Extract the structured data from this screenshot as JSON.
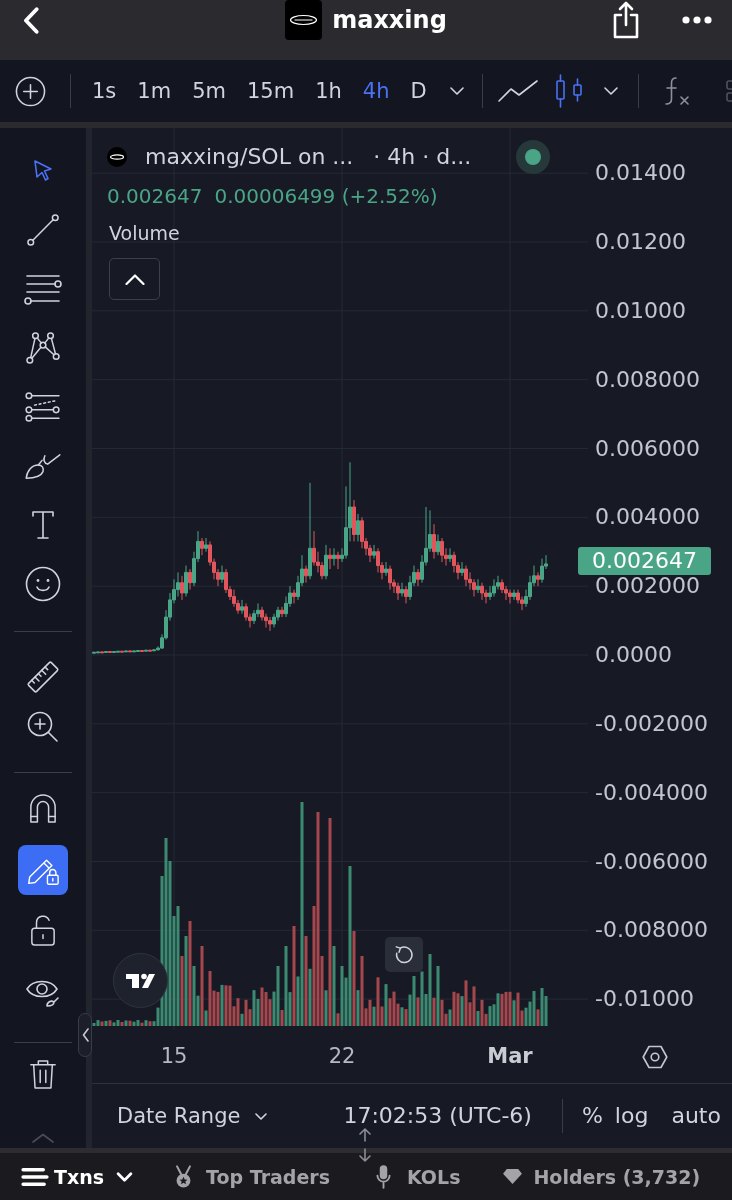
{
  "header": {
    "title": "maxxing"
  },
  "toolbar": {
    "intervals": [
      {
        "label": "1s",
        "selected": false
      },
      {
        "label": "1m",
        "selected": false
      },
      {
        "label": "5m",
        "selected": false
      },
      {
        "label": "15m",
        "selected": false
      },
      {
        "label": "1h",
        "selected": false
      },
      {
        "label": "4h",
        "selected": true
      },
      {
        "label": "D",
        "selected": false
      }
    ],
    "chart_types": [
      {
        "selected": false
      },
      {
        "selected": true
      }
    ]
  },
  "drawing_toolbar": {
    "tools": [
      {
        "selected": true
      },
      {
        "selected": false
      },
      {
        "selected": false
      },
      {
        "selected": false
      },
      {
        "selected": false
      },
      {
        "selected": false
      },
      {
        "selected": false
      },
      {
        "selected": false
      }
    ],
    "toggles": [
      {
        "on": false
      },
      {
        "on": true
      },
      {
        "on": false
      },
      {
        "on": false
      }
    ]
  },
  "chart": {
    "legend": {
      "symbol": "maxxing/SOL on ...",
      "details": "· 4h · d...",
      "price": "0.002647",
      "change": "0.00006499 (+2.52%)",
      "study": "Volume"
    },
    "last_price": "0.002647",
    "time_axis": {
      "ticks": [
        {
          "kind": "day"
        },
        {
          "kind": "day"
        },
        {
          "kind": "month"
        }
      ]
    },
    "chart_data": {
      "type": "candlestick",
      "grid": true,
      "xlim": [
        11.583,
        32.25
      ],
      "ylim": [
        -0.010897,
        0.015313
      ],
      "yticks": [
        {
          "value": 0.014,
          "label": "0.01400"
        },
        {
          "value": 0.012,
          "label": "0.01200"
        },
        {
          "value": 0.01,
          "label": "0.01000"
        },
        {
          "value": 0.008,
          "label": "0.008000"
        },
        {
          "value": 0.006,
          "label": "0.006000"
        },
        {
          "value": 0.004,
          "label": "0.004000"
        },
        {
          "value": 0.002,
          "label": "0.002000"
        },
        {
          "value": 0,
          "label": "0.0000"
        },
        {
          "value": -0.002,
          "label": "-0.002000"
        },
        {
          "value": -0.004,
          "label": "-0.004000"
        },
        {
          "value": -0.006,
          "label": "-0.006000"
        },
        {
          "value": -0.008,
          "label": "-0.008000"
        },
        {
          "value": -0.01,
          "label": "-0.01000"
        }
      ],
      "xticks": [
        {
          "value": 15,
          "label": "15"
        },
        {
          "value": 22,
          "label": "22"
        },
        {
          "value": 29,
          "label": "Mar"
        }
      ],
      "x": [
        11.667,
        11.833,
        12,
        12.167,
        12.333,
        12.5,
        12.667,
        12.833,
        13,
        13.167,
        13.333,
        13.5,
        13.667,
        13.833,
        14,
        14.167,
        14.333,
        14.5,
        14.667,
        14.833,
        15,
        15.167,
        15.333,
        15.5,
        15.667,
        15.833,
        16,
        16.167,
        16.333,
        16.5,
        16.667,
        16.833,
        17,
        17.167,
        17.333,
        17.5,
        17.667,
        17.833,
        18,
        18.167,
        18.333,
        18.5,
        18.667,
        18.833,
        19,
        19.167,
        19.333,
        19.5,
        19.667,
        19.833,
        20,
        20.167,
        20.333,
        20.5,
        20.667,
        20.833,
        21,
        21.167,
        21.333,
        21.5,
        21.667,
        21.833,
        22,
        22.167,
        22.333,
        22.5,
        22.667,
        22.833,
        23,
        23.167,
        23.333,
        23.5,
        23.667,
        23.833,
        24,
        24.167,
        24.333,
        24.5,
        24.667,
        24.833,
        25,
        25.167,
        25.333,
        25.5,
        25.667,
        25.833,
        26,
        26.167,
        26.333,
        26.5,
        26.667,
        26.833,
        27,
        27.167,
        27.333,
        27.5,
        27.667,
        27.833,
        28,
        28.167,
        28.333,
        28.5,
        28.667,
        28.833,
        29,
        29.167,
        29.333,
        29.5,
        29.667,
        29.833,
        30,
        30.167,
        30.333,
        30.5
      ],
      "ohlc": [
        [
          7e-05,
          9e-05,
          6e-05,
          8e-05
        ],
        [
          8e-05,
          0.0001,
          7e-05,
          9e-05
        ],
        [
          9e-05,
          0.0001,
          7e-05,
          8e-05
        ],
        [
          8e-05,
          0.00011,
          7e-05,
          0.0001
        ],
        [
          0.0001,
          0.00011,
          8e-05,
          9e-05
        ],
        [
          9e-05,
          0.00011,
          8e-05,
          0.0001
        ],
        [
          0.0001,
          0.00012,
          9e-05,
          0.00011
        ],
        [
          0.00011,
          0.00012,
          9e-05,
          0.0001
        ],
        [
          0.0001,
          0.00013,
          9e-05,
          0.00012
        ],
        [
          0.00012,
          0.00013,
          0.0001,
          0.00011
        ],
        [
          0.00011,
          0.00013,
          0.0001,
          0.00012
        ],
        [
          0.00012,
          0.00014,
          0.00011,
          0.00013
        ],
        [
          0.00013,
          0.00014,
          0.00011,
          0.00012
        ],
        [
          0.00012,
          0.00015,
          0.00011,
          0.00014
        ],
        [
          0.00014,
          0.00015,
          0.00012,
          0.00013
        ],
        [
          0.00013,
          0.00017,
          0.00012,
          0.00015
        ],
        [
          0.00015,
          0.00025,
          0.00013,
          0.0002
        ],
        [
          0.0002,
          0.0006,
          0.00018,
          0.0005
        ],
        [
          0.0005,
          0.0013,
          0.00045,
          0.0011
        ],
        [
          0.0011,
          0.0018,
          0.001,
          0.0016
        ],
        [
          0.0016,
          0.0022,
          0.0015,
          0.0019
        ],
        [
          0.0019,
          0.0024,
          0.0017,
          0.0021
        ],
        [
          0.0021,
          0.0023,
          0.0016,
          0.0018
        ],
        [
          0.0018,
          0.0026,
          0.0017,
          0.0024
        ],
        [
          0.0024,
          0.0025,
          0.0019,
          0.0021
        ],
        [
          0.0021,
          0.003,
          0.002,
          0.0028
        ],
        [
          0.0028,
          0.0036,
          0.0027,
          0.0033
        ],
        [
          0.0033,
          0.0034,
          0.0029,
          0.0031
        ],
        [
          0.0031,
          0.0034,
          0.003,
          0.0032
        ],
        [
          0.0032,
          0.0033,
          0.0026,
          0.0027
        ],
        [
          0.0027,
          0.0028,
          0.0022,
          0.0024
        ],
        [
          0.0024,
          0.0025,
          0.002,
          0.0022
        ],
        [
          0.0022,
          0.0026,
          0.0021,
          0.0024
        ],
        [
          0.0024,
          0.0025,
          0.0018,
          0.0019
        ],
        [
          0.0019,
          0.002,
          0.0016,
          0.0017
        ],
        [
          0.0017,
          0.0019,
          0.0014,
          0.0015
        ],
        [
          0.0015,
          0.0016,
          0.0012,
          0.0013
        ],
        [
          0.0013,
          0.0016,
          0.0012,
          0.0014
        ],
        [
          0.0014,
          0.0015,
          0.001,
          0.0011
        ],
        [
          0.0011,
          0.0012,
          0.0008,
          0.001
        ],
        [
          0.001,
          0.0013,
          0.0009,
          0.0012
        ],
        [
          0.0012,
          0.0015,
          0.0011,
          0.0013
        ],
        [
          0.0013,
          0.0014,
          0.001,
          0.0011
        ],
        [
          0.0011,
          0.0012,
          0.0008,
          0.001
        ],
        [
          0.001,
          0.0011,
          0.0007,
          0.0009
        ],
        [
          0.0009,
          0.0012,
          0.0008,
          0.0011
        ],
        [
          0.0011,
          0.0014,
          0.001,
          0.0013
        ],
        [
          0.0013,
          0.0014,
          0.0011,
          0.0012
        ],
        [
          0.0012,
          0.0017,
          0.0011,
          0.0015
        ],
        [
          0.0015,
          0.002,
          0.0014,
          0.0018
        ],
        [
          0.0018,
          0.0019,
          0.0015,
          0.0017
        ],
        [
          0.0017,
          0.0023,
          0.0016,
          0.0021
        ],
        [
          0.0021,
          0.0029,
          0.002,
          0.0025
        ],
        [
          0.0025,
          0.0026,
          0.0021,
          0.0023
        ],
        [
          0.0023,
          0.005,
          0.0022,
          0.0031
        ],
        [
          0.0031,
          0.0036,
          0.0026,
          0.0027
        ],
        [
          0.0027,
          0.003,
          0.0024,
          0.0026
        ],
        [
          0.0026,
          0.0027,
          0.0022,
          0.0023
        ],
        [
          0.0023,
          0.0032,
          0.0022,
          0.0029
        ],
        [
          0.0029,
          0.0031,
          0.0025,
          0.0028
        ],
        [
          0.0028,
          0.0031,
          0.0026,
          0.0029
        ],
        [
          0.0029,
          0.003,
          0.0025,
          0.0028
        ],
        [
          0.0028,
          0.0031,
          0.0027,
          0.0029
        ],
        [
          0.0029,
          0.0049,
          0.0028,
          0.0037
        ],
        [
          0.0037,
          0.0056,
          0.0033,
          0.0043
        ],
        [
          0.0043,
          0.0045,
          0.0033,
          0.0035
        ],
        [
          0.0035,
          0.0041,
          0.0033,
          0.0039
        ],
        [
          0.0039,
          0.004,
          0.0031,
          0.0033
        ],
        [
          0.0033,
          0.0034,
          0.0029,
          0.0031
        ],
        [
          0.0031,
          0.0032,
          0.0027,
          0.0029
        ],
        [
          0.0029,
          0.0032,
          0.0028,
          0.003
        ],
        [
          0.003,
          0.0031,
          0.0024,
          0.0026
        ],
        [
          0.0026,
          0.0027,
          0.0022,
          0.0024
        ],
        [
          0.0024,
          0.0027,
          0.0023,
          0.0025
        ],
        [
          0.0025,
          0.0026,
          0.0019,
          0.0021
        ],
        [
          0.0021,
          0.0022,
          0.0018,
          0.002
        ],
        [
          0.002,
          0.0021,
          0.0016,
          0.0018
        ],
        [
          0.0018,
          0.0021,
          0.0017,
          0.0019
        ],
        [
          0.0019,
          0.002,
          0.0015,
          0.0017
        ],
        [
          0.0017,
          0.0023,
          0.0016,
          0.0021
        ],
        [
          0.0021,
          0.0026,
          0.002,
          0.0024
        ],
        [
          0.0024,
          0.0025,
          0.002,
          0.0022
        ],
        [
          0.0022,
          0.0029,
          0.0021,
          0.0027
        ],
        [
          0.0027,
          0.0043,
          0.0026,
          0.0031
        ],
        [
          0.0031,
          0.0042,
          0.003,
          0.0035
        ],
        [
          0.0035,
          0.0038,
          0.0028,
          0.003
        ],
        [
          0.003,
          0.0035,
          0.0029,
          0.0033
        ],
        [
          0.0033,
          0.0034,
          0.0027,
          0.0029
        ],
        [
          0.0029,
          0.0031,
          0.0026,
          0.0028
        ],
        [
          0.0028,
          0.0031,
          0.0027,
          0.0029
        ],
        [
          0.0029,
          0.003,
          0.0024,
          0.0026
        ],
        [
          0.0026,
          0.0027,
          0.0022,
          0.0024
        ],
        [
          0.0024,
          0.0027,
          0.0023,
          0.0025
        ],
        [
          0.0025,
          0.0026,
          0.002,
          0.0022
        ],
        [
          0.0022,
          0.0024,
          0.0019,
          0.0021
        ],
        [
          0.0021,
          0.0022,
          0.0017,
          0.0019
        ],
        [
          0.0019,
          0.0022,
          0.0018,
          0.002
        ],
        [
          0.002,
          0.0021,
          0.0016,
          0.0018
        ],
        [
          0.0018,
          0.0019,
          0.0015,
          0.0017
        ],
        [
          0.0017,
          0.002,
          0.0016,
          0.0018
        ],
        [
          0.0018,
          0.0022,
          0.0017,
          0.002
        ],
        [
          0.002,
          0.0023,
          0.0019,
          0.0021
        ],
        [
          0.0021,
          0.0022,
          0.0018,
          0.0019
        ],
        [
          0.0019,
          0.002,
          0.0016,
          0.0018
        ],
        [
          0.0018,
          0.0019,
          0.0015,
          0.0017
        ],
        [
          0.0017,
          0.0019,
          0.0016,
          0.0018
        ],
        [
          0.0018,
          0.0019,
          0.0015,
          0.0016
        ],
        [
          0.0016,
          0.0017,
          0.0013,
          0.0015
        ],
        [
          0.0015,
          0.0019,
          0.0014,
          0.0017
        ],
        [
          0.0017,
          0.0023,
          0.0016,
          0.0021
        ],
        [
          0.0021,
          0.0026,
          0.002,
          0.0023
        ],
        [
          0.0023,
          0.0024,
          0.002,
          0.0022
        ],
        [
          0.0022,
          0.0028,
          0.0021,
          0.002582
        ],
        [
          0.002582,
          0.0029,
          0.0025,
          0.002647
        ]
      ]
    }
  },
  "footer": {
    "date_range": "Date Range",
    "time": "17:02:53 (UTC-6)",
    "scale_options": [
      "%",
      "log",
      "auto"
    ]
  },
  "bottom_tabs": [
    {
      "label": "Txns",
      "selected": true
    },
    {
      "label": "Top Traders",
      "selected": false
    },
    {
      "label": "KOLs",
      "selected": false
    },
    {
      "label": "Holders (3,732)",
      "selected": false
    }
  ]
}
